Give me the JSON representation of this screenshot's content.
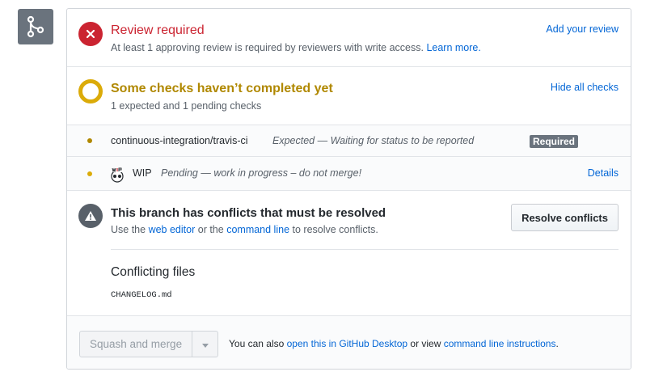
{
  "colors": {
    "danger": "#cb2431",
    "pending": "#dbab09",
    "link": "#0366d6",
    "muted": "#6a737d"
  },
  "merge_icon": "git-merge-icon",
  "review": {
    "title": "Review required",
    "description": "At least 1 approving review is required by reviewers with write access.",
    "learn_more": "Learn more.",
    "add_review": "Add your review",
    "icon": "x-icon"
  },
  "checks": {
    "title": "Some checks haven’t completed yet",
    "summary": "1 expected and 1 pending checks",
    "hide_all": "Hide all checks",
    "items": [
      {
        "name": "continuous-integration/travis-ci",
        "description": "Expected — Waiting for status to be reported",
        "badge": "Required"
      },
      {
        "name": "WIP",
        "description": "Pending — work in progress – do not merge!",
        "details": "Details",
        "icon": "wip-icon"
      }
    ]
  },
  "conflicts": {
    "title": "This branch has conflicts that must be resolved",
    "use_the": "Use the",
    "web_editor": "web editor",
    "or_the": "or the",
    "command_line": "command line",
    "to_resolve": "to resolve conflicts.",
    "resolve_button": "Resolve conflicts",
    "files_title": "Conflicting files",
    "files": [
      "CHANGELOG.md"
    ],
    "icon": "alert-icon"
  },
  "merge": {
    "button": "Squash and merge",
    "caret_icon": "caret-down-icon",
    "you_can_also": "You can also",
    "open_desktop": "open this in GitHub Desktop",
    "or_view": "or view",
    "cli_instructions": "command line instructions",
    "period": "."
  }
}
